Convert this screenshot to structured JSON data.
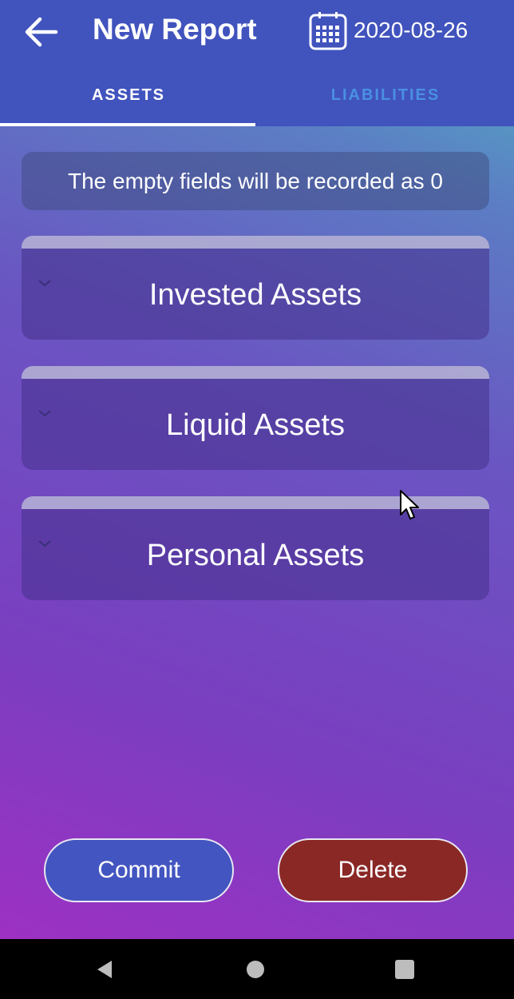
{
  "header": {
    "title": "New Report",
    "date": "2020-08-26",
    "back_icon": "arrow-left-icon",
    "calendar_icon": "calendar-icon"
  },
  "tabs": [
    {
      "label": "ASSETS",
      "active": true
    },
    {
      "label": "LIABILITIES",
      "active": false
    }
  ],
  "notice": "The empty fields will be recorded as 0",
  "sections": [
    {
      "label": "Invested Assets"
    },
    {
      "label": "Liquid Assets"
    },
    {
      "label": "Personal Assets"
    }
  ],
  "actions": {
    "commit_label": "Commit",
    "delete_label": "Delete"
  },
  "colors": {
    "appbar": "#4153bd",
    "inactive_tab": "#4a90e2",
    "commit_button": "#4355c0",
    "delete_button": "#8a2826"
  },
  "system_nav": {
    "back_icon": "nav-back-triangle-icon",
    "home_icon": "nav-home-circle-icon",
    "recents_icon": "nav-recents-square-icon"
  }
}
